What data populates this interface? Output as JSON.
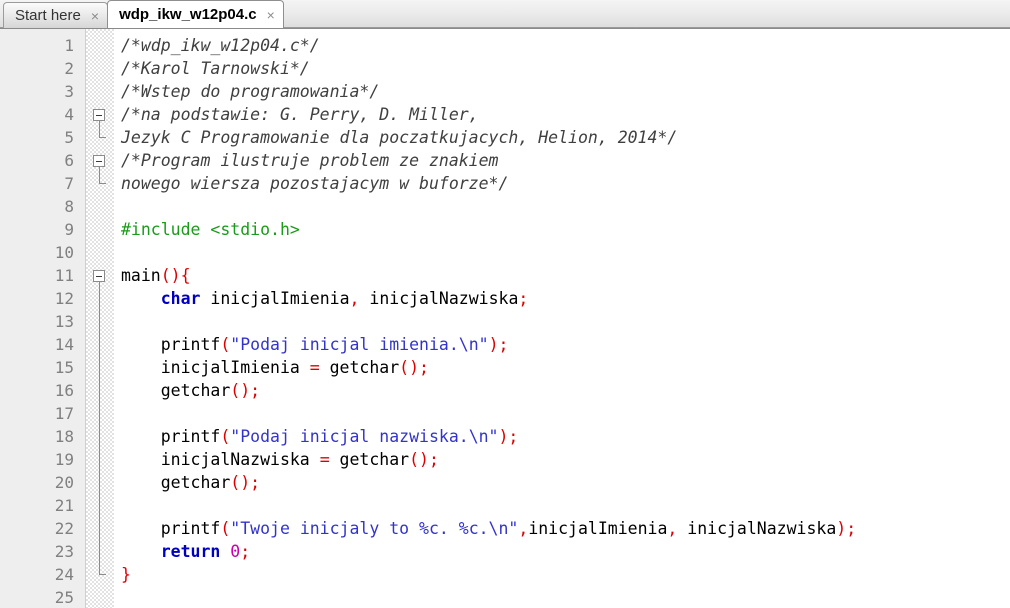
{
  "window": {
    "title": "wdp_ikw_w12p04.c"
  },
  "tabs": [
    {
      "label": "Start here",
      "close": "×",
      "active": false
    },
    {
      "label": "wdp_ikw_w12p04.c",
      "close": "×",
      "active": true
    }
  ],
  "editor": {
    "line_numbers": [
      "1",
      "2",
      "3",
      "4",
      "5",
      "6",
      "7",
      "8",
      "9",
      "10",
      "11",
      "12",
      "13",
      "14",
      "15",
      "16",
      "17",
      "18",
      "19",
      "20",
      "21",
      "22",
      "23",
      "24",
      "25"
    ],
    "total_lines": 25,
    "language": "C",
    "lines": [
      {
        "num": "1",
        "fold": "none",
        "tokens": [
          {
            "t": "comment",
            "v": "/*wdp_ikw_w12p04.c*/"
          }
        ]
      },
      {
        "num": "2",
        "fold": "none",
        "tokens": [
          {
            "t": "comment",
            "v": "/*Karol Tarnowski*/"
          }
        ]
      },
      {
        "num": "3",
        "fold": "none",
        "tokens": [
          {
            "t": "comment",
            "v": "/*Wstep do programowania*/"
          }
        ]
      },
      {
        "num": "4",
        "fold": "open",
        "tokens": [
          {
            "t": "comment",
            "v": "/*na podstawie: G. Perry, D. Miller,"
          }
        ]
      },
      {
        "num": "5",
        "fold": "end",
        "tokens": [
          {
            "t": "comment",
            "v": "Jezyk C Programowanie dla poczatkujacych, Helion, 2014*/"
          }
        ]
      },
      {
        "num": "6",
        "fold": "open",
        "tokens": [
          {
            "t": "comment",
            "v": "/*Program ilustruje problem ze znakiem"
          }
        ]
      },
      {
        "num": "7",
        "fold": "end",
        "tokens": [
          {
            "t": "comment",
            "v": "nowego wiersza pozostajacym w buforze*/"
          }
        ]
      },
      {
        "num": "8",
        "fold": "none",
        "tokens": []
      },
      {
        "num": "9",
        "fold": "none",
        "tokens": [
          {
            "t": "pre",
            "v": "#include <stdio.h>"
          }
        ]
      },
      {
        "num": "10",
        "fold": "none",
        "tokens": []
      },
      {
        "num": "11",
        "fold": "open",
        "tokens": [
          {
            "t": "plain",
            "v": "main"
          },
          {
            "t": "op",
            "v": "(){"
          }
        ]
      },
      {
        "num": "12",
        "fold": "line",
        "tokens": [
          {
            "t": "plain",
            "v": "    "
          },
          {
            "t": "kw",
            "v": "char"
          },
          {
            "t": "plain",
            "v": " inicjalImienia"
          },
          {
            "t": "op",
            "v": ","
          },
          {
            "t": "plain",
            "v": " inicjalNazwiska"
          },
          {
            "t": "op",
            "v": ";"
          }
        ]
      },
      {
        "num": "13",
        "fold": "line",
        "tokens": []
      },
      {
        "num": "14",
        "fold": "line",
        "tokens": [
          {
            "t": "plain",
            "v": "    printf"
          },
          {
            "t": "op",
            "v": "("
          },
          {
            "t": "str",
            "v": "\"Podaj inicjal imienia.\\n\""
          },
          {
            "t": "op",
            "v": ");"
          }
        ]
      },
      {
        "num": "15",
        "fold": "line",
        "tokens": [
          {
            "t": "plain",
            "v": "    inicjalImienia "
          },
          {
            "t": "op",
            "v": "="
          },
          {
            "t": "plain",
            "v": " getchar"
          },
          {
            "t": "op",
            "v": "();"
          }
        ]
      },
      {
        "num": "16",
        "fold": "line",
        "tokens": [
          {
            "t": "plain",
            "v": "    getchar"
          },
          {
            "t": "op",
            "v": "();"
          }
        ]
      },
      {
        "num": "17",
        "fold": "line",
        "tokens": []
      },
      {
        "num": "18",
        "fold": "line",
        "tokens": [
          {
            "t": "plain",
            "v": "    printf"
          },
          {
            "t": "op",
            "v": "("
          },
          {
            "t": "str",
            "v": "\"Podaj inicjal nazwiska.\\n\""
          },
          {
            "t": "op",
            "v": ");"
          }
        ]
      },
      {
        "num": "19",
        "fold": "line",
        "tokens": [
          {
            "t": "plain",
            "v": "    inicjalNazwiska "
          },
          {
            "t": "op",
            "v": "="
          },
          {
            "t": "plain",
            "v": " getchar"
          },
          {
            "t": "op",
            "v": "();"
          }
        ]
      },
      {
        "num": "20",
        "fold": "line",
        "tokens": [
          {
            "t": "plain",
            "v": "    getchar"
          },
          {
            "t": "op",
            "v": "();"
          }
        ]
      },
      {
        "num": "21",
        "fold": "line",
        "tokens": []
      },
      {
        "num": "22",
        "fold": "line",
        "tokens": [
          {
            "t": "plain",
            "v": "    printf"
          },
          {
            "t": "op",
            "v": "("
          },
          {
            "t": "str",
            "v": "\"Twoje inicjaly to %c. %c.\\n\""
          },
          {
            "t": "op",
            "v": ","
          },
          {
            "t": "plain",
            "v": "inicjalImienia"
          },
          {
            "t": "op",
            "v": ","
          },
          {
            "t": "plain",
            "v": " inicjalNazwiska"
          },
          {
            "t": "op",
            "v": ");"
          }
        ]
      },
      {
        "num": "23",
        "fold": "line",
        "tokens": [
          {
            "t": "plain",
            "v": "    "
          },
          {
            "t": "kw",
            "v": "return"
          },
          {
            "t": "plain",
            "v": " "
          },
          {
            "t": "num",
            "v": "0"
          },
          {
            "t": "op",
            "v": ";"
          }
        ]
      },
      {
        "num": "24",
        "fold": "end",
        "tokens": [
          {
            "t": "op",
            "v": "}"
          }
        ]
      },
      {
        "num": "25",
        "fold": "none",
        "tokens": []
      }
    ]
  },
  "colors": {
    "comment": "#404040",
    "preprocessor": "#1a9b1a",
    "keyword": "#0000c0",
    "string": "#3333cc",
    "number": "#cc00aa",
    "operator": "#dd0000",
    "plain": "#000000",
    "gutter_bg": "#eeeeee",
    "gutter_text": "#808080",
    "editor_bg": "#ffffff",
    "active_tab_bg": "#ffffff",
    "inactive_tab_bg": "#ededed"
  }
}
